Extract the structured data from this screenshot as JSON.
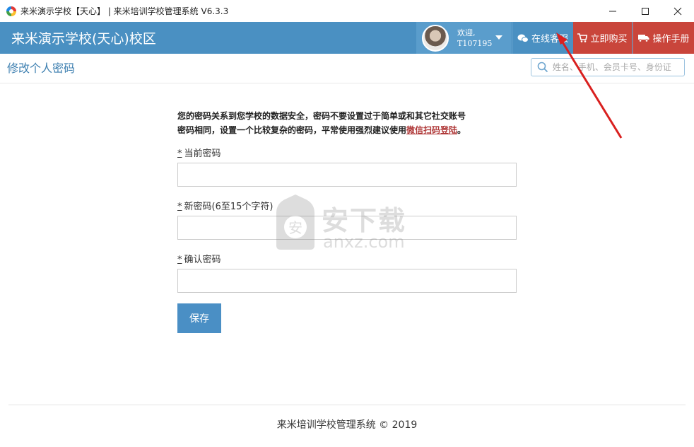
{
  "window": {
    "title": "来米演示学校【天心】 | 来米培训学校管理系统 V6.3.3"
  },
  "header": {
    "school_name": "来米演示学校(天心)校区",
    "user": {
      "greeting": "欢迎,",
      "user_id": "T107195"
    },
    "service_label": "在线客服",
    "buy_label": "立即购买",
    "manual_label": "操作手册"
  },
  "page": {
    "title": "修改个人密码",
    "search_placeholder": "姓名、手机、会员卡号、身份证"
  },
  "form": {
    "notice_line1": "您的密码关系到您学校的数据安全，密码不要设置过于简单或和其它社交账号",
    "notice_line2": "密码相同，设置一个比较复杂的密码，平常使用强烈建议使用",
    "notice_link": "微信扫码登陆",
    "notice_end": "。",
    "required_mark": "*",
    "current_label": "当前密码",
    "new_label": "新密码(6至15个字符)",
    "confirm_label": "确认密码",
    "save_label": "保存"
  },
  "watermark": {
    "main": "安下载",
    "sub": "anxz.com"
  },
  "footer": {
    "text": "来米培训学校管理系统 © 2019"
  },
  "colors": {
    "header": "#4a90c2",
    "buy": "#c9453b",
    "arrow": "#d9201f"
  }
}
